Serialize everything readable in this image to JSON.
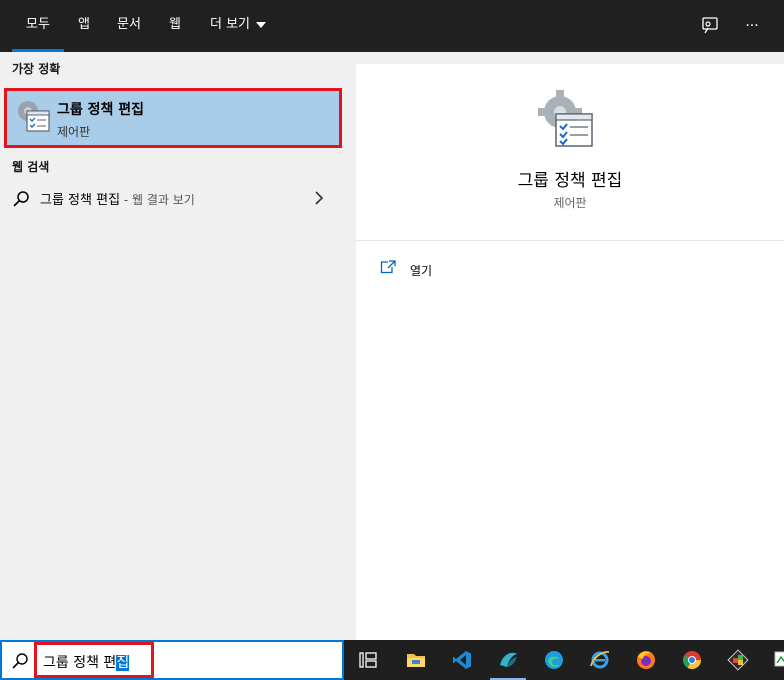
{
  "top_tabs": [
    {
      "label": "모두",
      "active": true
    },
    {
      "label": "앱"
    },
    {
      "label": "문서"
    },
    {
      "label": "웹"
    },
    {
      "label": "더 보기"
    }
  ],
  "top_icons": [
    "feedback-icon",
    "more-options-icon"
  ],
  "more_label": "···",
  "left": {
    "best_match_title": "가장 정확",
    "best_match": {
      "name": "그룹 정책 편집",
      "subtitle": "제어판"
    },
    "web_title": "웹 검색",
    "web_result": {
      "query": "그룹 정책 편집",
      "suffix": " - 웹 결과 보기"
    }
  },
  "right": {
    "title": "그룹 정책 편집",
    "subtitle": "제어판",
    "actions": [
      {
        "label": "열기",
        "icon": "open-icon"
      }
    ]
  },
  "search": {
    "value_before_selection": "그룹 정책 편",
    "value_selected": "집"
  },
  "taskbar_icons": [
    "task-view-icon",
    "file-explorer-icon",
    "vscode-icon",
    "app-icon",
    "edge-icon",
    "ie-icon",
    "firefox-icon",
    "chrome-icon",
    "tool-icon",
    "monitor-icon"
  ],
  "colors": {
    "accent": "#0078d7",
    "highlight": "#a9cde9",
    "annotation": "#e0151e",
    "topbar": "#202020"
  }
}
